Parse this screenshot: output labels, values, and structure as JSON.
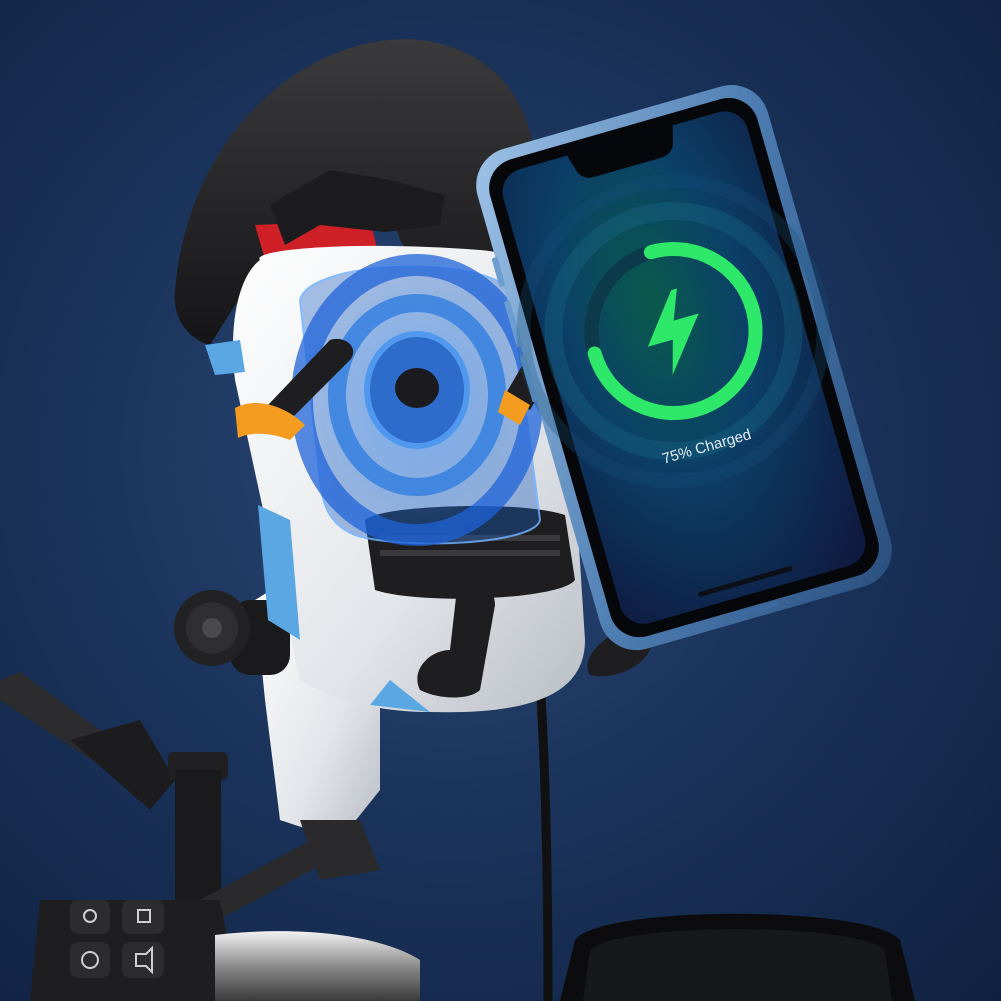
{
  "phone": {
    "status_text": "75% Charged",
    "charge_level": 0.75,
    "ring_color": "#2ee86a",
    "bolt_color": "#2ee86a",
    "screen_colors": [
      "#0a5a4c",
      "#0b3f68",
      "#101a40"
    ]
  },
  "scene": {
    "background_color": "#1b345c",
    "holder_body_color": "#e8ebee",
    "wireless_field_color": "#2f7de0",
    "accent_colors": [
      "#f39c1f",
      "#d8232a",
      "#5aa7e3"
    ]
  },
  "icons": {
    "charging": "lightning-bolt-icon",
    "handlebar_switches": [
      "mode-icon",
      "light-icon",
      "power-icon",
      "horn-icon"
    ]
  }
}
